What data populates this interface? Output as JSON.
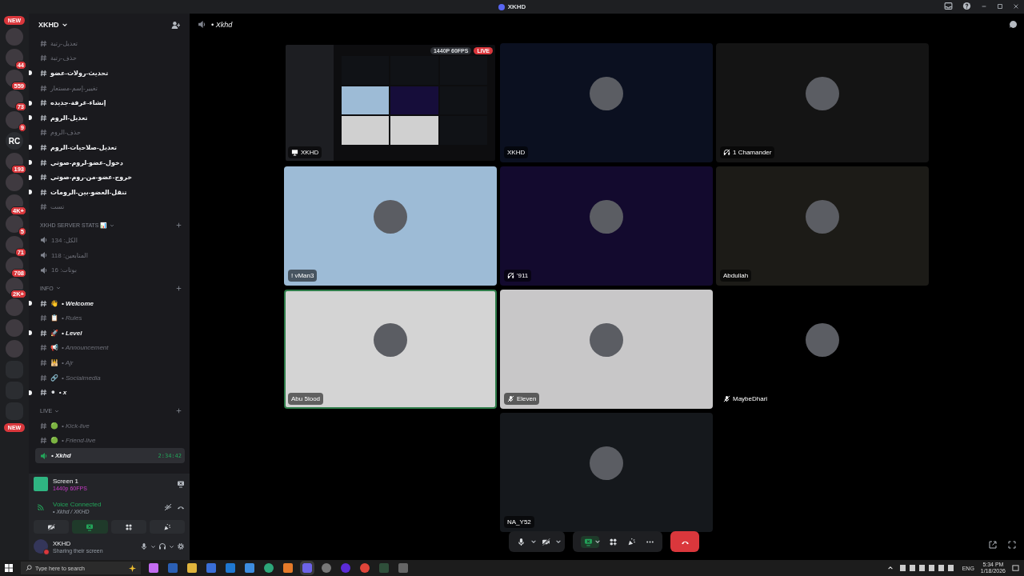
{
  "window": {
    "title": "XKHD"
  },
  "servers": [
    {
      "kind": "new",
      "label": "NEW"
    },
    {
      "kind": "photo"
    },
    {
      "kind": "photo",
      "badge": "44"
    },
    {
      "kind": "photo",
      "badge": "559"
    },
    {
      "kind": "photo",
      "badge": "73"
    },
    {
      "kind": "photo",
      "badge": "9"
    },
    {
      "kind": "text",
      "label": "RC"
    },
    {
      "kind": "photo",
      "badge": "193"
    },
    {
      "kind": "photo"
    },
    {
      "kind": "photo",
      "badge": "4K+"
    },
    {
      "kind": "photo",
      "badge": "5"
    },
    {
      "kind": "photo",
      "badge": "71"
    },
    {
      "kind": "photo",
      "badge": "708"
    },
    {
      "kind": "photo",
      "badge": "2K+"
    },
    {
      "kind": "photo"
    },
    {
      "kind": "photo"
    },
    {
      "kind": "photo"
    },
    {
      "kind": "folder"
    },
    {
      "kind": "folder"
    },
    {
      "kind": "folder"
    },
    {
      "kind": "new",
      "label": "NEW"
    }
  ],
  "server": {
    "name": "XKHD"
  },
  "top_channels": [
    {
      "name": "تعديل-رتبة",
      "unread": false,
      "selected": false
    },
    {
      "name": "حذف-رتبة",
      "unread": false,
      "selected": false
    },
    {
      "name": "تحديث-رولات-عضو",
      "unread": true,
      "selected": false
    },
    {
      "name": "تغيير-إسم-مستعار",
      "unread": false,
      "selected": false
    },
    {
      "name": "إنشاء-غرفة-جديده",
      "unread": true,
      "selected": false
    },
    {
      "name": "تعديل-الروم",
      "unread": true,
      "selected": false
    },
    {
      "name": "حذف-الروم",
      "unread": false,
      "selected": false
    },
    {
      "name": "تعديل-صلاحيات-الروم",
      "unread": true,
      "selected": false
    },
    {
      "name": "دخول-عضو-لروم-صوتي",
      "unread": true,
      "selected": false
    },
    {
      "name": "خروج-عضو-من-روم-صوتي",
      "unread": true,
      "selected": false
    },
    {
      "name": "تنقل-العضو-بين-الرومات",
      "unread": true,
      "selected": false
    },
    {
      "name": "تست",
      "unread": false,
      "selected": false
    }
  ],
  "categories": [
    {
      "name": "XKHD SERVER STATS 📊",
      "channels": [
        {
          "kind": "voice",
          "name": "الكل: 134",
          "unread": false,
          "selected": false
        },
        {
          "kind": "voice",
          "name": "المتابعين: 118",
          "unread": false,
          "selected": false
        },
        {
          "kind": "voice",
          "name": "بوتات: 16",
          "unread": false,
          "selected": false
        }
      ]
    },
    {
      "name": "INFO",
      "channels": [
        {
          "kind": "text",
          "emoji": "👋",
          "name": "• Welcome",
          "unread": true,
          "selected": false
        },
        {
          "kind": "text",
          "emoji": "📋",
          "name": "• Rules",
          "unread": false,
          "selected": false
        },
        {
          "kind": "text",
          "emoji": "🚀",
          "name": "• Level",
          "unread": true,
          "selected": false
        },
        {
          "kind": "text",
          "emoji": "📢",
          "name": "• Announcement",
          "unread": false,
          "selected": false
        },
        {
          "kind": "text",
          "emoji": "🕌",
          "name": "• Ajr",
          "unread": false,
          "selected": false
        },
        {
          "kind": "text",
          "emoji": "🔗",
          "name": "• Socialmedia",
          "unread": false,
          "selected": false
        },
        {
          "kind": "text",
          "emoji": "⚫",
          "name": "• x",
          "unread": true,
          "selected": false
        }
      ]
    },
    {
      "name": "LIVE",
      "channels": [
        {
          "kind": "text",
          "emoji": "🟢",
          "name": "• Kick-live",
          "unread": false,
          "selected": false
        },
        {
          "kind": "text",
          "emoji": "🟢",
          "name": "• Friend-live",
          "unread": false,
          "selected": false
        },
        {
          "kind": "voice",
          "name": "• Xkhd",
          "unread": false,
          "selected": true,
          "timer": "2:34:42"
        }
      ]
    }
  ],
  "stream": {
    "title": "Screen 1",
    "quality": "1440p 60FPS"
  },
  "voice": {
    "status": "Voice Connected",
    "location": "• Xkhd / XKHD"
  },
  "user": {
    "name": "XKHD",
    "status": "Sharing their screen"
  },
  "call": {
    "channel": "• Xkhd",
    "screen_sharing": true,
    "camera_off": true
  },
  "tiles": [
    {
      "kind": "stream",
      "name": "XKHD",
      "quality": "1440P 60FPS",
      "live": "LIVE",
      "muted": false,
      "deafened": false,
      "speaking": false,
      "color": "#000000"
    },
    {
      "kind": "avatar",
      "name": "XKHD",
      "muted": false,
      "deafened": false,
      "speaking": false,
      "color": "#0b1020"
    },
    {
      "kind": "avatar",
      "name": "1 Chamander",
      "muted": false,
      "deafened": true,
      "speaking": false,
      "color": "#141414"
    },
    {
      "kind": "avatar",
      "name": "! vMan3",
      "muted": false,
      "deafened": false,
      "speaking": false,
      "color": "#9dbbd6"
    },
    {
      "kind": "avatar",
      "name": "'911",
      "muted": false,
      "deafened": true,
      "speaking": false,
      "color": "#130a2e"
    },
    {
      "kind": "avatar",
      "name": "Abdullah",
      "muted": false,
      "deafened": false,
      "speaking": false,
      "color": "#1c1b17"
    },
    {
      "kind": "avatar",
      "name": "Abu 5lood",
      "muted": false,
      "deafened": false,
      "speaking": true,
      "color": "#d4d4d4"
    },
    {
      "kind": "avatar",
      "name": "Eleven",
      "muted": true,
      "deafened": false,
      "speaking": false,
      "color": "#c8c7c8"
    },
    {
      "kind": "avatar",
      "name": "MaybeDhari",
      "muted": true,
      "deafened": false,
      "speaking": false,
      "color": "#000000"
    },
    {
      "kind": "avatar",
      "name": "NA_Y52",
      "muted": false,
      "deafened": false,
      "speaking": false,
      "color": "#15181c"
    }
  ],
  "taskbar": {
    "search_placeholder": "Type here to search",
    "language": "ENG",
    "time": "5:34 PM",
    "date": "1/18/2026"
  }
}
